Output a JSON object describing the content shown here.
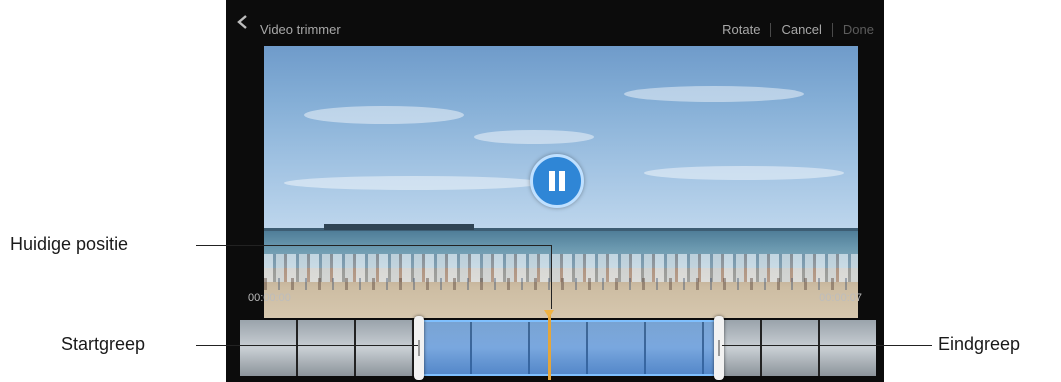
{
  "action_bar": {
    "back_icon": "chevron-left-icon",
    "title": "Video trimmer",
    "rotate_label": "Rotate",
    "cancel_label": "Cancel",
    "done_label": "Done"
  },
  "player": {
    "pause_icon": "pause-icon",
    "time_start": "00:00:00",
    "time_end": "00:00:07",
    "accent_color": "#2f86d6",
    "playhead_color": "#e5a63a"
  },
  "trim": {
    "selected_start_fraction": 0.29,
    "selected_end_fraction": 0.77,
    "playhead_fraction": 0.53
  },
  "callouts": {
    "current_position": "Huidige positie",
    "start_handle": "Startgreep",
    "end_handle": "Eindgreep"
  }
}
